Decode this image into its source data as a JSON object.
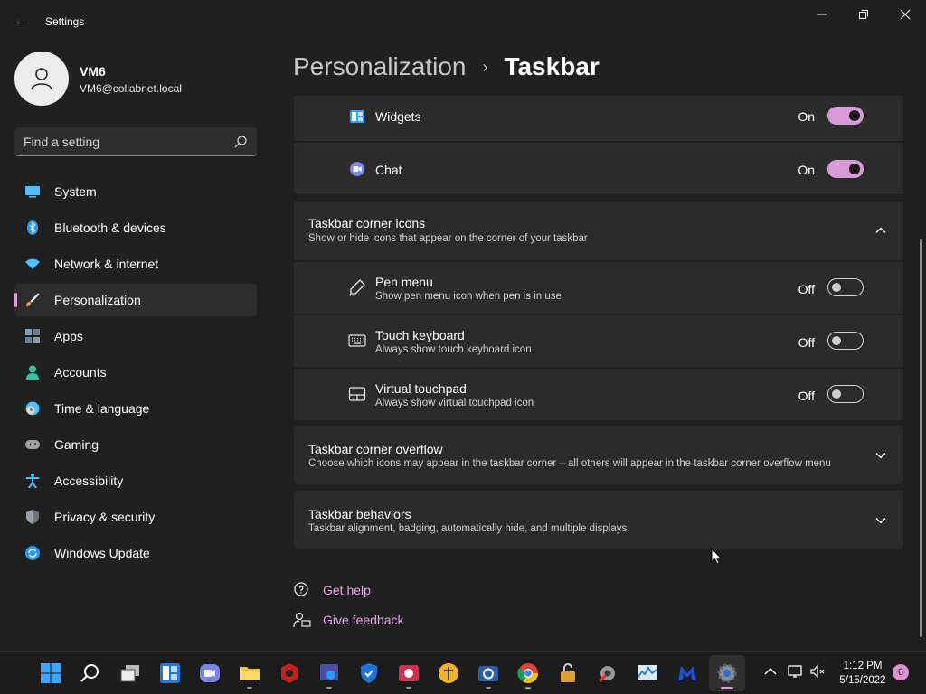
{
  "window": {
    "title": "Settings"
  },
  "profile": {
    "name": "VM6",
    "email": "VM6@collabnet.local"
  },
  "search": {
    "placeholder": "Find a setting"
  },
  "nav": {
    "items": [
      {
        "label": "System",
        "icon": "monitor-icon",
        "color": "#4cc2ff"
      },
      {
        "label": "Bluetooth & devices",
        "icon": "bluetooth-icon",
        "color": "#2b9bf0"
      },
      {
        "label": "Network & internet",
        "icon": "wifi-icon",
        "color": "#4cc2ff"
      },
      {
        "label": "Personalization",
        "icon": "brush-icon",
        "color": "#f0a06a",
        "active": true
      },
      {
        "label": "Apps",
        "icon": "apps-icon",
        "color": "#8a9bb0"
      },
      {
        "label": "Accounts",
        "icon": "person-icon",
        "color": "#2fc49a"
      },
      {
        "label": "Time & language",
        "icon": "globe-clock-icon",
        "color": "#4cc2ff"
      },
      {
        "label": "Gaming",
        "icon": "gamepad-icon",
        "color": "#a0a0a0"
      },
      {
        "label": "Accessibility",
        "icon": "accessibility-icon",
        "color": "#4cc2ff"
      },
      {
        "label": "Privacy & security",
        "icon": "shield-icon",
        "color": "#9aa0a6"
      },
      {
        "label": "Windows Update",
        "icon": "update-icon",
        "color": "#2b9bf0"
      }
    ]
  },
  "breadcrumb": {
    "parent": "Personalization",
    "separator": "›",
    "current": "Taskbar"
  },
  "taskbar_items": {
    "widgets": {
      "label": "Widgets",
      "state": "On"
    },
    "chat": {
      "label": "Chat",
      "state": "On"
    }
  },
  "corner_icons": {
    "title": "Taskbar corner icons",
    "subtitle": "Show or hide icons that appear on the corner of your taskbar",
    "items": [
      {
        "label": "Pen menu",
        "sub": "Show pen menu icon when pen is in use",
        "state": "Off"
      },
      {
        "label": "Touch keyboard",
        "sub": "Always show touch keyboard icon",
        "state": "Off"
      },
      {
        "label": "Virtual touchpad",
        "sub": "Always show virtual touchpad icon",
        "state": "Off"
      }
    ]
  },
  "corner_overflow": {
    "title": "Taskbar corner overflow",
    "subtitle": "Choose which icons may appear in the taskbar corner – all others will appear in the taskbar corner overflow menu"
  },
  "behaviors": {
    "title": "Taskbar behaviors",
    "subtitle": "Taskbar alignment, badging, automatically hide, and multiple displays"
  },
  "help": {
    "get_help": "Get help",
    "give_feedback": "Give feedback"
  },
  "accent_color": "#e59ddc",
  "clock": {
    "time": "1:12 PM",
    "date": "5/15/2022"
  },
  "notification_count": "6"
}
